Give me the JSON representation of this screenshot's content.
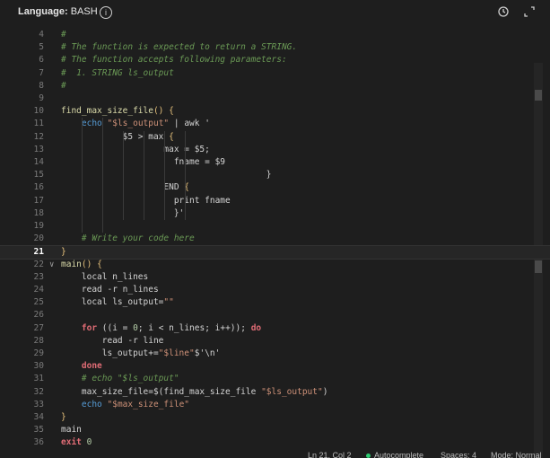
{
  "header": {
    "language_prefix": "Language:",
    "language_value": "BASH",
    "info_icon": "info-icon",
    "history_icon": "history-icon",
    "expand_icon": "expand-icon"
  },
  "editor": {
    "active_line": "21",
    "lines": [
      {
        "num": "4",
        "text": "#"
      },
      {
        "num": "5",
        "text": "# The function is expected to return a STRING."
      },
      {
        "num": "6",
        "text": "# The function accepts following parameters:"
      },
      {
        "num": "7",
        "text": "#  1. STRING ls_output"
      },
      {
        "num": "8",
        "text": "#"
      },
      {
        "num": "9",
        "text": ""
      },
      {
        "num": "10",
        "text": "find_max_size_file() {"
      },
      {
        "num": "11",
        "text": "    echo \"$ls_output\" | awk '"
      },
      {
        "num": "12",
        "text": "            $5 > max {"
      },
      {
        "num": "13",
        "text": "                    max = $5;"
      },
      {
        "num": "14",
        "text": "                      fname = $9"
      },
      {
        "num": "15",
        "text": "                                        }"
      },
      {
        "num": "16",
        "text": "                    END {"
      },
      {
        "num": "17",
        "text": "                      print fname"
      },
      {
        "num": "18",
        "text": "                      }'"
      },
      {
        "num": "19",
        "text": ""
      },
      {
        "num": "20",
        "text": "    # Write your code here"
      },
      {
        "num": "21",
        "text": "}"
      },
      {
        "num": "22",
        "text": "main() {"
      },
      {
        "num": "23",
        "text": "    local n_lines"
      },
      {
        "num": "24",
        "text": "    read -r n_lines"
      },
      {
        "num": "25",
        "text": "    local ls_output=\"\""
      },
      {
        "num": "26",
        "text": ""
      },
      {
        "num": "27",
        "text": "    for ((i = 0; i < n_lines; i++)); do"
      },
      {
        "num": "28",
        "text": "        read -r line"
      },
      {
        "num": "29",
        "text": "        ls_output+=\"$line\"$'\\n'"
      },
      {
        "num": "30",
        "text": "    done"
      },
      {
        "num": "31",
        "text": "    # echo \"$ls_output\""
      },
      {
        "num": "32",
        "text": "    max_size_file=$(find_max_size_file \"$ls_output\")"
      },
      {
        "num": "33",
        "text": "    echo \"$max_size_file\""
      },
      {
        "num": "34",
        "text": "}"
      },
      {
        "num": "35",
        "text": "main"
      },
      {
        "num": "36",
        "text": "exit 0"
      }
    ]
  },
  "status_bar": {
    "cursor_pos": "Ln 21, Col 2",
    "autocomplete": "Autocomplete",
    "spaces": "Spaces: 4",
    "mode": "Mode: Normal"
  }
}
